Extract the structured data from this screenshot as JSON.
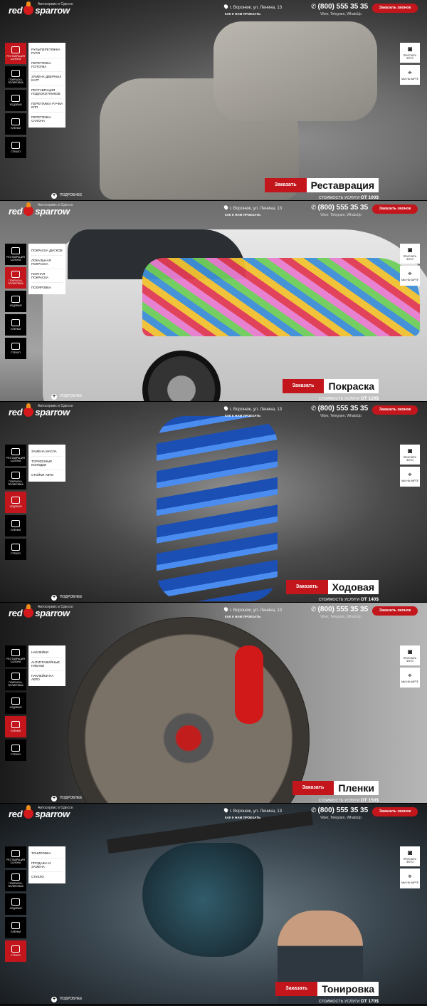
{
  "brand": {
    "logo_left": "red",
    "logo_right": "sparrow",
    "tagline": "Автосервис в Одессе"
  },
  "header": {
    "address": "г. Воронеж, ул. Ленина, 13",
    "how_to_get": "Как к нам проехать",
    "phone": "(800) 555 35 35",
    "messengers": "Viber, Telegram, WhatsUp",
    "call_button": "Заказать звонок"
  },
  "categories": [
    {
      "label": "Реставрация салона",
      "icon": "seat-icon"
    },
    {
      "label": "Покраска, полировка",
      "icon": "spray-gun-icon"
    },
    {
      "label": "Ходовая",
      "icon": "axle-icon"
    },
    {
      "label": "Пленки",
      "icon": "film-icon"
    },
    {
      "label": "Стекло",
      "icon": "windshield-icon"
    }
  ],
  "tools": [
    {
      "label": "Прислать фото",
      "icon": "camera-icon",
      "glyph": "◙"
    },
    {
      "label": "Мы на карте",
      "icon": "map-pin-icon",
      "glyph": "⌖"
    }
  ],
  "order_label": "Заказать",
  "price_prefix": "Стоимость услуги",
  "more_label": "Подробнее",
  "panels": [
    {
      "active": 0,
      "service": "Реставрация",
      "price": "от 100$",
      "submenu": [
        "Рулыперетяжка руля",
        "Перетяжка потолка",
        "Замена дверных карт",
        "Реставрация подлокотников",
        "Перетяжка ручки КПП",
        "Перетяжка салона"
      ]
    },
    {
      "active": 1,
      "service": "Покраска",
      "price": "от 120$",
      "submenu": [
        "Покраска дисков",
        "Локальная покраска",
        "Полная покраска",
        "Полировка"
      ]
    },
    {
      "active": 2,
      "service": "Ходовая",
      "price": "от 140$",
      "submenu": [
        "Замена масла",
        "Тормозные колодки",
        "Стойки авто"
      ]
    },
    {
      "active": 3,
      "service": "Пленки",
      "price": "от 150$",
      "submenu": [
        "Наклейки",
        "Антигравийные пленки",
        "Наклейки на авто"
      ]
    },
    {
      "active": 4,
      "service": "Тонировка",
      "price": "от 170$",
      "submenu": [
        "Тонировка",
        "Продажа и замена",
        "Стекло"
      ]
    }
  ]
}
